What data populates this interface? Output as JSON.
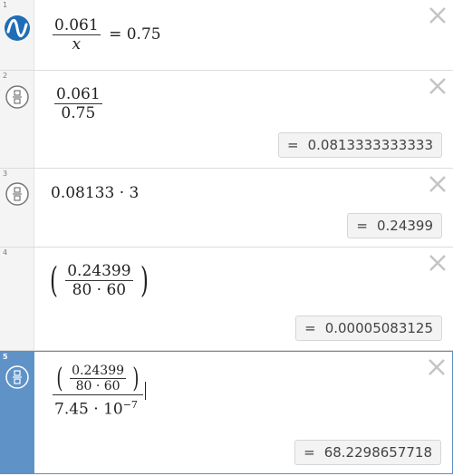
{
  "expressions": [
    {
      "num": "1",
      "icon": "desmos-logo-icon",
      "numerator": "0.061",
      "denominator": "x",
      "rest": "= 0.75"
    },
    {
      "num": "2",
      "icon": "fraction-icon",
      "numerator": "0.061",
      "denominator": "0.75",
      "result": "0.0813333333333"
    },
    {
      "num": "3",
      "icon": "fraction-icon",
      "text": "0.08133 · 3",
      "result": "0.24399"
    },
    {
      "num": "4",
      "numerator": "0.24399",
      "denominator": "80 · 60",
      "result": "0.00005083125"
    },
    {
      "num": "5",
      "icon": "fraction-icon",
      "inner_numerator": "0.24399",
      "inner_denominator": "80 · 60",
      "denominator_base": "7.45 · 10",
      "denominator_exp": "−7",
      "result": "68.2298657718"
    }
  ],
  "result_eq": "=",
  "colors": {
    "active_gutter": "#5f93c8",
    "logo": "#1f6db5"
  }
}
